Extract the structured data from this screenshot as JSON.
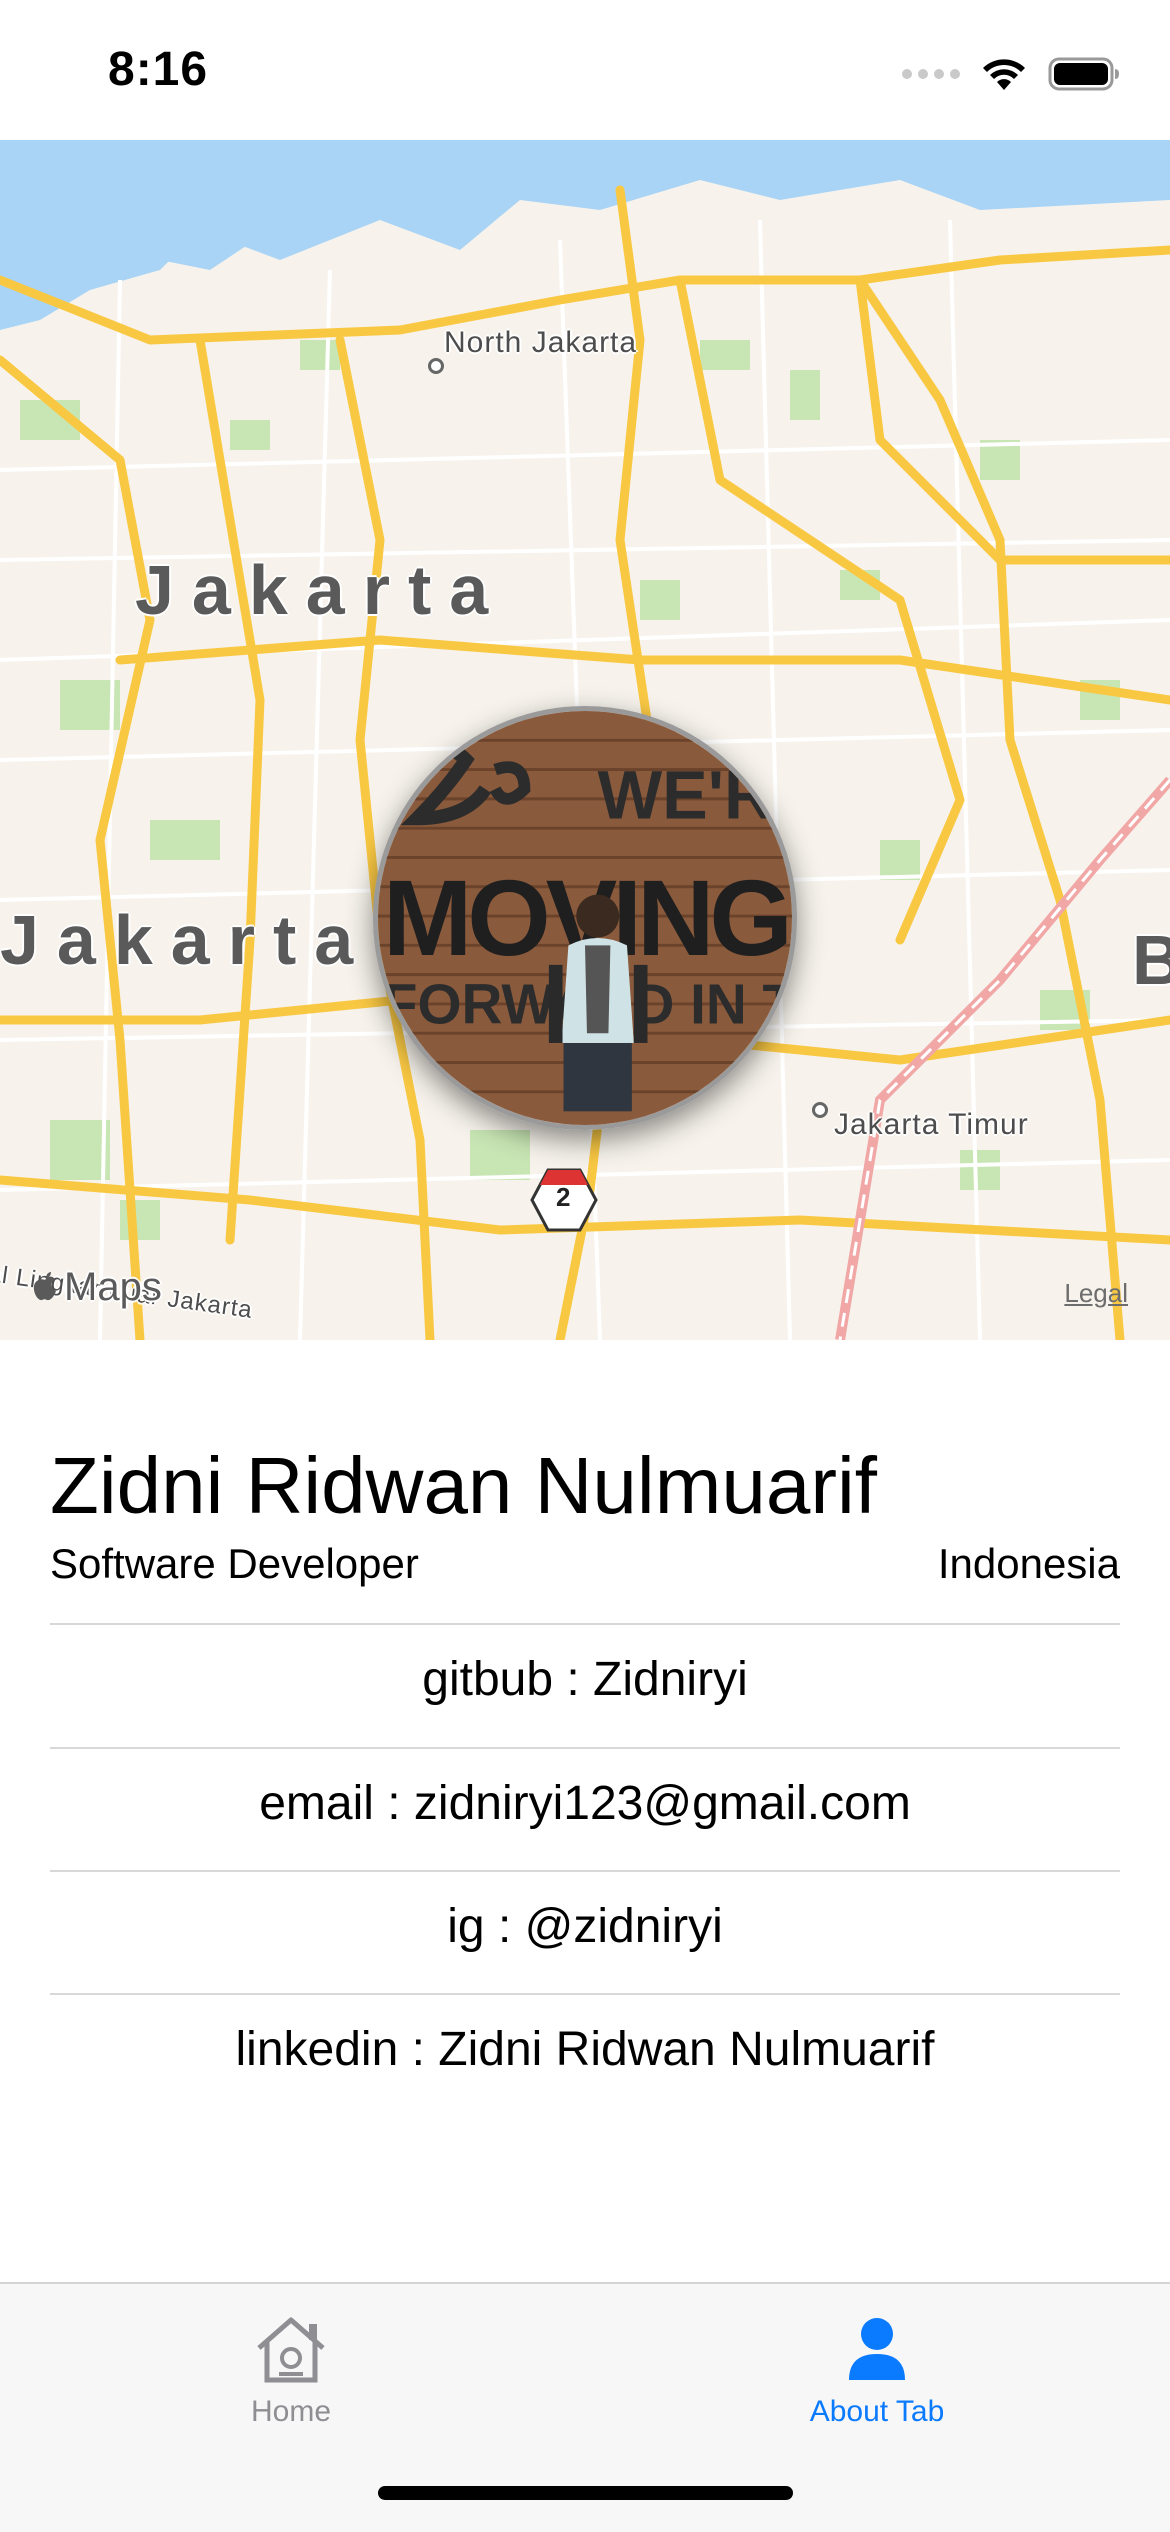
{
  "status_bar": {
    "time": "8:16",
    "icons": [
      "signal-icon",
      "wifi-icon",
      "battery-icon"
    ]
  },
  "map": {
    "labels": {
      "north_jakarta": "North Jakarta",
      "jakarta_main": "Jakarta",
      "jakarta_west": "Jakarta",
      "jakarta_timur": "Jakarta Timur",
      "b_edge": "B",
      "lingkar": "al Lingkar Luar Jakarta",
      "route_shield": "2"
    },
    "maps_logo": "Maps",
    "legal": "Legal",
    "avatar_texts": {
      "line1": "WE'R",
      "line2": "MOVING",
      "line3": "FORWARD IN TI"
    }
  },
  "profile": {
    "name": "Zidni Ridwan Nulmuarif",
    "role": "Software Developer",
    "country": "Indonesia"
  },
  "contacts": {
    "github": "gitbub : Zidniryi",
    "email": "email : zidniryi123@gmail.com",
    "instagram": "ig : @zidniryi",
    "linkedin": "linkedin : Zidni Ridwan Nulmuarif"
  },
  "tab_bar": {
    "home_label": "Home",
    "about_label": "About Tab",
    "active": "About Tab",
    "active_color": "#0a7aff",
    "inactive_color": "#8e8e93"
  }
}
